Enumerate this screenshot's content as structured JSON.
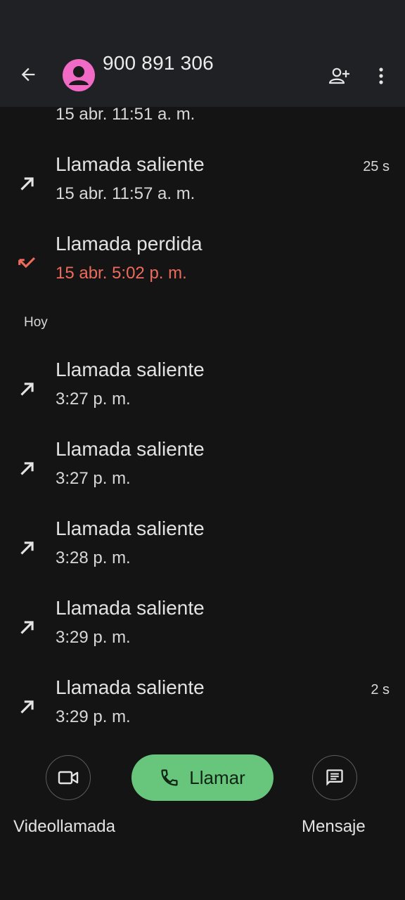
{
  "header": {
    "title": "900 891 306"
  },
  "log": {
    "partial_entry_time": "15 abr. 11:51 a. m.",
    "entries_before": [
      {
        "type": "Llamada saliente",
        "time": "15 abr. 11:57 a. m.",
        "duration": "25 s",
        "kind": "outgoing"
      },
      {
        "type": "Llamada perdida",
        "time": "15 abr. 5:02 p. m.",
        "duration": "",
        "kind": "missed"
      }
    ],
    "section_today": "Hoy",
    "entries_today": [
      {
        "type": "Llamada saliente",
        "time": "3:27 p. m.",
        "duration": "",
        "kind": "outgoing"
      },
      {
        "type": "Llamada saliente",
        "time": "3:27 p. m.",
        "duration": "",
        "kind": "outgoing"
      },
      {
        "type": "Llamada saliente",
        "time": "3:28 p. m.",
        "duration": "",
        "kind": "outgoing"
      },
      {
        "type": "Llamada saliente",
        "time": "3:29 p. m.",
        "duration": "",
        "kind": "outgoing"
      },
      {
        "type": "Llamada saliente",
        "time": "3:29 p. m.",
        "duration": "2 s",
        "kind": "outgoing"
      }
    ]
  },
  "actions": {
    "video_label": "Videollamada",
    "call_label": "Llamar",
    "message_label": "Mensaje"
  },
  "icons": {
    "back": "arrow-left-icon",
    "avatar": "person-icon",
    "add_contact": "person-add-icon",
    "more": "more-vert-icon",
    "outgoing": "call-made-icon",
    "missed": "call-missed-icon",
    "video": "videocam-icon",
    "phone": "phone-icon",
    "message": "message-icon"
  },
  "colors": {
    "background": "#141414",
    "header": "#202124",
    "avatar": "#f06ac6",
    "missed": "#ee6b5c",
    "call_button": "#67c67c"
  }
}
